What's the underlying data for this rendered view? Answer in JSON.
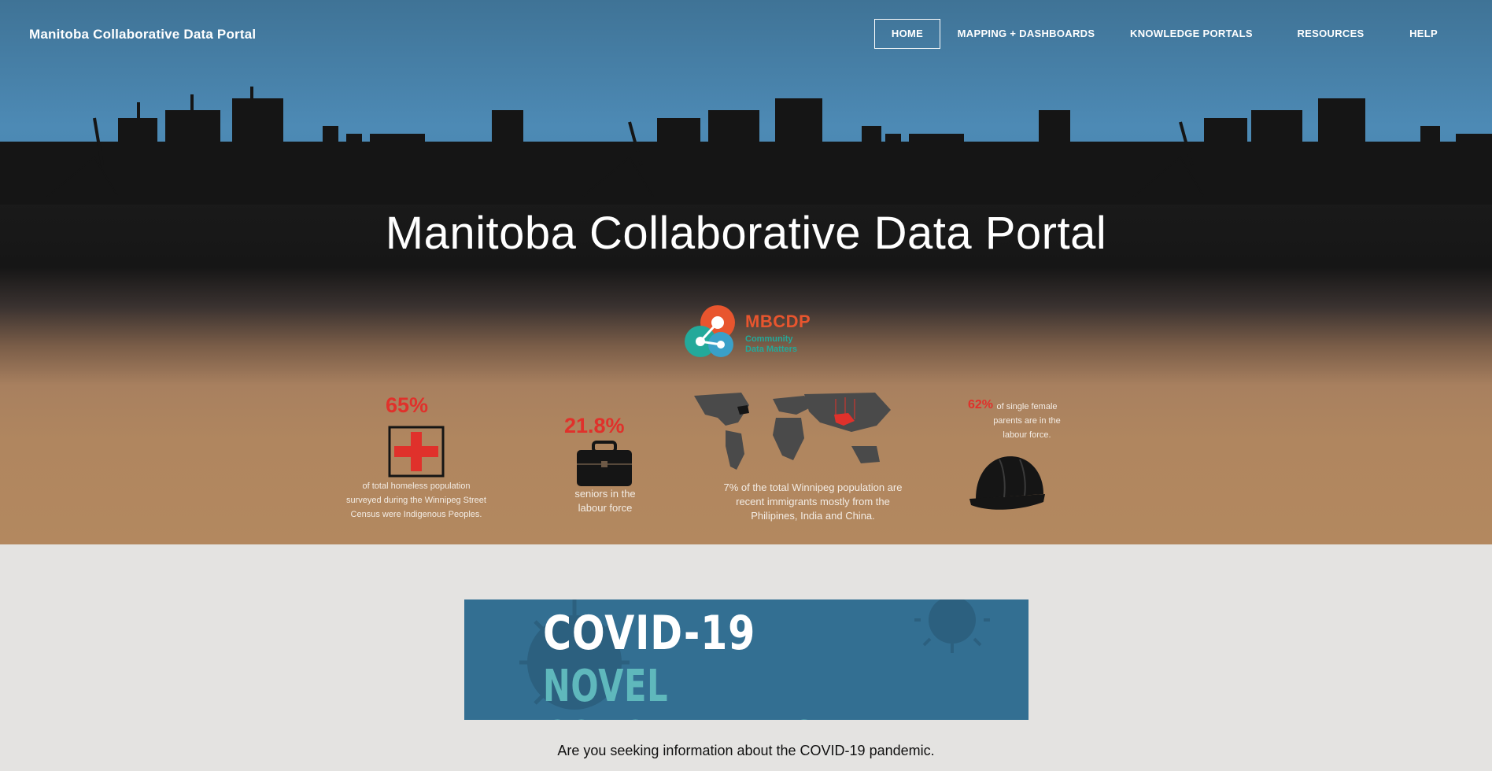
{
  "header": {
    "brand": "Manitoba Collaborative Data Portal",
    "nav": [
      {
        "label": "HOME",
        "active": true
      },
      {
        "label": "MAPPING + DASHBOARDS",
        "active": false
      },
      {
        "label": "KNOWLEDGE PORTALS",
        "active": false
      },
      {
        "label": "RESOURCES",
        "active": false
      },
      {
        "label": "HELP",
        "active": false
      }
    ]
  },
  "hero": {
    "title": "Manitoba Collaborative Data Portal",
    "logo": {
      "name": "MBCDP",
      "tagline_1": "Community",
      "tagline_2": "Data Matters"
    }
  },
  "stats": [
    {
      "value": "65%",
      "icon": "medical-cross-icon",
      "text_1": "of total homeless population",
      "text_2": "surveyed  during the Winnipeg Street",
      "text_3": "Census were Indigenous Peoples."
    },
    {
      "value": "21.8%",
      "icon": "briefcase-icon",
      "text_1": "seniors in the",
      "text_2": "labour force"
    },
    {
      "icon": "world-map-icon",
      "text_1": "7% of the total Winnipeg population are",
      "text_2": "recent immigrants mostly from the",
      "text_3": "Philipines, India and China."
    },
    {
      "value": "62%",
      "icon": "hard-hat-icon",
      "text_1": "of single female",
      "text_2": "parents are in the",
      "text_3": "labour force."
    }
  ],
  "covid": {
    "banner_line_1": "COVID-19",
    "banner_line_2": "NOVEL CORONAVIRUS",
    "question": "Are you seeking information about the COVID-19 pandemic."
  },
  "colors": {
    "accent_red": "#e0312b",
    "logo_orange": "#e8552e",
    "logo_teal": "#23a99a",
    "banner_blue": "#336f92",
    "banner_teal_text": "#5fb8bc"
  }
}
